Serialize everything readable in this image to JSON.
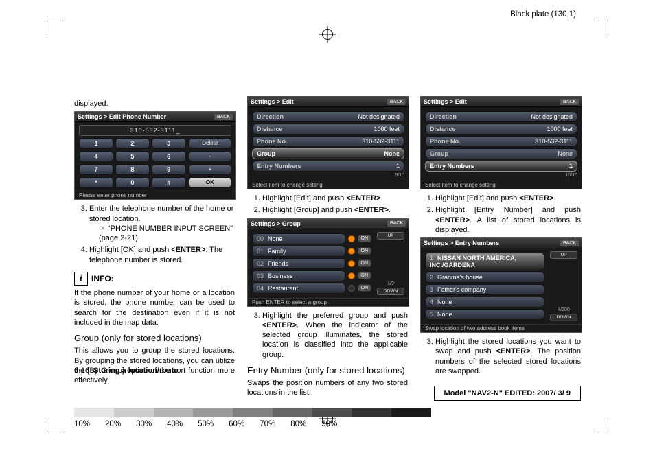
{
  "header_plate": "Black plate (130,1)",
  "percents": [
    "10%",
    "20%",
    "30%",
    "40%",
    "50%",
    "60%",
    "70%",
    "80%",
    "90%"
  ],
  "footer": {
    "page": "6-16",
    "section": "Storing a location/route"
  },
  "model_edited": "Model \"NAV2-N\" EDITED: 2007/ 3/ 9",
  "col1": {
    "displayed": "displayed.",
    "shot_phone": {
      "crumb": "Settings > Edit Phone Number",
      "back": "BACK",
      "value": "310-532-3111_",
      "keys": [
        [
          "1",
          "2",
          "3"
        ],
        [
          "4",
          "5",
          "6"
        ],
        [
          "7",
          "8",
          "9"
        ],
        [
          "*",
          "0",
          "#"
        ]
      ],
      "side": [
        "Delete",
        "-",
        "+",
        "OK"
      ],
      "hint": "Please enter phone number"
    },
    "step3": "Enter the telephone number of the home or stored location.",
    "ref_icon": "☞",
    "ref": "“PHONE NUMBER INPUT SCREEN” (page 2-21)",
    "step4a": "Highlight [OK] and push ",
    "step4b": "<ENTER>",
    "step4c": ". The telephone number is stored.",
    "info_label": "INFO:",
    "info_body": "If the phone number of your home or a location is stored, the phone number can be used to search for the destination even if it is not included in the map data.",
    "sub": "Group (only for stored locations)",
    "sub_body": "This allows you to group the stored locations. By grouping the stored locations, you can utilize the [By Group] option of the sort function more effectively."
  },
  "col2": {
    "shot_edit": {
      "crumb": "Settings > Edit",
      "back": "BACK",
      "rows": [
        {
          "lab": "Direction",
          "val": "Not designated"
        },
        {
          "lab": "Distance",
          "val": "1000 feet"
        },
        {
          "lab": "Phone No.",
          "val": "310-532-3111"
        },
        {
          "lab": "Group",
          "val": "None",
          "sel": true
        },
        {
          "lab": "Entry Numbers",
          "val": "1"
        }
      ],
      "count": "9/10",
      "hint": "Select item to change setting"
    },
    "s1a": "Highlight [Edit] and push ",
    "s1b": "<ENTER>",
    "s1c": ".",
    "s2a": "Highlight [Group] and push ",
    "s2b": "<ENTER>",
    "s2c": ".",
    "shot_group": {
      "crumb": "Settings > Group",
      "back": "BACK",
      "up": "UP",
      "down": "DOWN",
      "items": [
        {
          "idx": "00",
          "name": "None",
          "on": true
        },
        {
          "idx": "01",
          "name": "Family",
          "on": true
        },
        {
          "idx": "02",
          "name": "Friends",
          "on": true
        },
        {
          "idx": "03",
          "name": "Business",
          "on": true
        },
        {
          "idx": "04",
          "name": "Restaurant",
          "on": false
        }
      ],
      "count": "1/9",
      "hint": "Push ENTER to select a group"
    },
    "s3a": "Highlight the preferred group and push ",
    "s3b": "<ENTER>",
    "s3c": ". When the indicator of the selected group illuminates, the stored location is classified into the applicable group.",
    "sub": "Entry Number (only for stored locations)",
    "sub_body": "Swaps the position numbers of any two stored locations in the list."
  },
  "col3": {
    "shot_edit": {
      "crumb": "Settings > Edit",
      "back": "BACK",
      "rows": [
        {
          "lab": "Direction",
          "val": "Not designated"
        },
        {
          "lab": "Distance",
          "val": "1000 feet"
        },
        {
          "lab": "Phone No.",
          "val": "310-532-3111"
        },
        {
          "lab": "Group",
          "val": "None"
        },
        {
          "lab": "Entry Numbers",
          "val": "1",
          "sel": true
        }
      ],
      "count": "10/10",
      "hint": "Select item to change setting"
    },
    "s1a": "Highlight [Edit] and push ",
    "s1b": "<ENTER>",
    "s1c": ".",
    "s2a": "Highlight [Entry Number] and push ",
    "s2b": "<ENTER>",
    "s2c": ". A list of stored locations is displayed.",
    "shot_entry": {
      "crumb": "Settings > Entry Numbers",
      "back": "BACK",
      "up": "UP",
      "down": "DOWN",
      "items": [
        {
          "idx": "1",
          "name": "NISSAN NORTH AMERICA, INC./GARDENA",
          "hi": true
        },
        {
          "idx": "2",
          "name": "Granma's house"
        },
        {
          "idx": "3",
          "name": "Father's company"
        },
        {
          "idx": "4",
          "name": "None"
        },
        {
          "idx": "5",
          "name": "None"
        }
      ],
      "count": "4/200",
      "hint": "Swap location of two address book items"
    },
    "s3a": "Highlight the stored locations you want to swap and push ",
    "s3b": "<ENTER>",
    "s3c": ". The position numbers of the selected stored locations are swapped."
  }
}
